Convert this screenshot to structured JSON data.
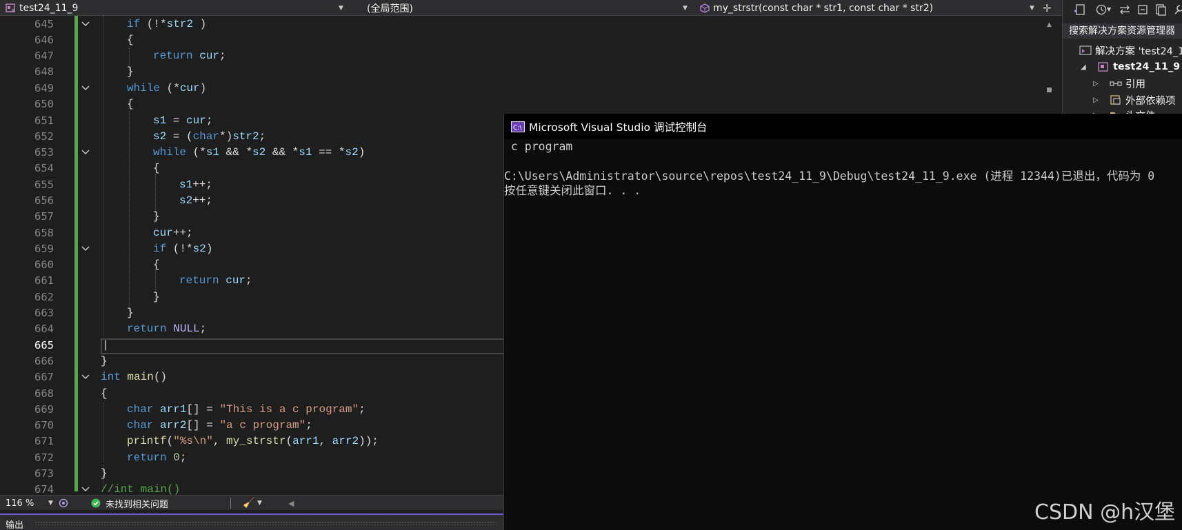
{
  "navbar": {
    "project": "test24_11_9",
    "scope": "(全局范围)",
    "function": "my_strstr(const char * str1, const char * str2)"
  },
  "editor": {
    "lines": [
      {
        "n": "645"
      },
      {
        "n": "646"
      },
      {
        "n": "647"
      },
      {
        "n": "648"
      },
      {
        "n": "649"
      },
      {
        "n": "650"
      },
      {
        "n": "651"
      },
      {
        "n": "652"
      },
      {
        "n": "653"
      },
      {
        "n": "654"
      },
      {
        "n": "655"
      },
      {
        "n": "656"
      },
      {
        "n": "657"
      },
      {
        "n": "658"
      },
      {
        "n": "659"
      },
      {
        "n": "660"
      },
      {
        "n": "661"
      },
      {
        "n": "662"
      },
      {
        "n": "663"
      },
      {
        "n": "664"
      },
      {
        "n": "665"
      },
      {
        "n": "666"
      },
      {
        "n": "667"
      },
      {
        "n": "668"
      },
      {
        "n": "669"
      },
      {
        "n": "670"
      },
      {
        "n": "671"
      },
      {
        "n": "672"
      },
      {
        "n": "673"
      },
      {
        "n": "674"
      }
    ],
    "current_line": "665"
  },
  "status": {
    "zoom": "116 %",
    "issues": "未找到相关问题"
  },
  "output_panel": {
    "label": "输出"
  },
  "solution_explorer": {
    "search": "搜索解决方案资源管理器",
    "items": [
      {
        "label": "解决方案 'test24_1"
      },
      {
        "label": "test24_11_9"
      },
      {
        "label": "引用"
      },
      {
        "label": "外部依赖项"
      },
      {
        "label": "头文件"
      }
    ]
  },
  "console": {
    "title": "Microsoft Visual Studio 调试控制台",
    "lines": [
      " c program",
      "",
      "C:\\Users\\Administrator\\source\\repos\\test24_11_9\\Debug\\test24_11_9.exe (进程 12344)已退出，代码为 0",
      "按任意键关闭此窗口. . ."
    ]
  },
  "watermark": "CSDN @h汉堡"
}
